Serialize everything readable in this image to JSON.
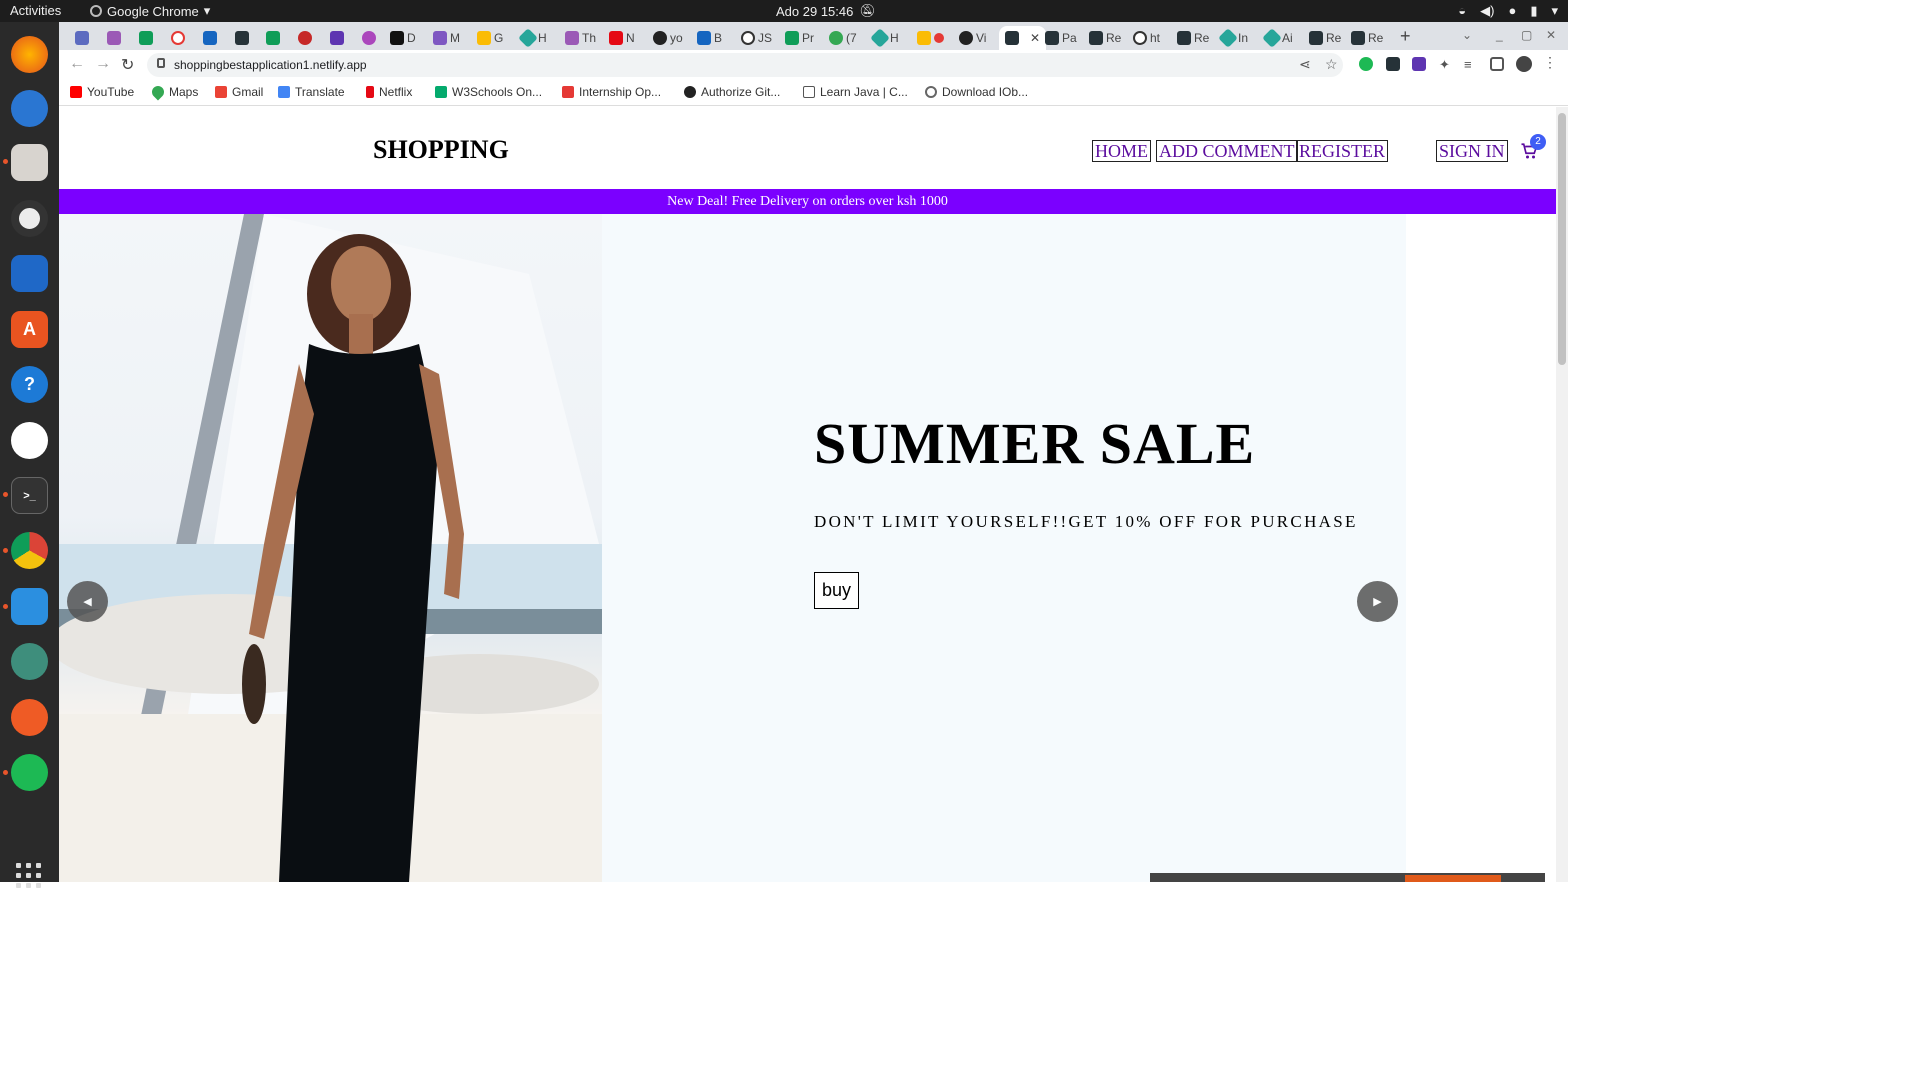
{
  "system": {
    "activities": "Activities",
    "app_name": "Google Chrome",
    "clock": "Ado 29  15:46"
  },
  "browser": {
    "tabs": [
      "D",
      "M",
      "G",
      "H",
      "Th",
      "N",
      "yo",
      "B",
      "JS",
      "Pr",
      "(7",
      "H",
      "Vi",
      "",
      "Pa",
      "Re",
      "ht",
      "Re",
      "In",
      "Ai",
      "Re",
      "Re"
    ],
    "active_tab_index": 13,
    "url": "shoppingbestapplication1.netlify.app",
    "bookmarks": [
      "YouTube",
      "Maps",
      "Gmail",
      "Translate",
      "Netflix",
      "W3Schools On...",
      "Internship Op...",
      "Authorize Git...",
      "Learn Java | C...",
      "Download IOb..."
    ]
  },
  "site": {
    "logo": "SHOPPING",
    "nav": {
      "home": "HOME",
      "add_comment": "ADD COMMENT",
      "register": "REGISTER",
      "sign_in": "SIGN IN"
    },
    "cart_count": "2",
    "announcement": "New Deal! Free Delivery on orders over ksh 1000",
    "slide": {
      "title": "SUMMER SALE",
      "description": "DON'T LIMIT YOURSELF!!GET 10% OFF FOR PURCHASE",
      "button": "buy"
    },
    "colors": {
      "accent": "#7b00ff",
      "nav_text": "#5b0c9e",
      "slide_bg": "#f5fafd"
    }
  }
}
